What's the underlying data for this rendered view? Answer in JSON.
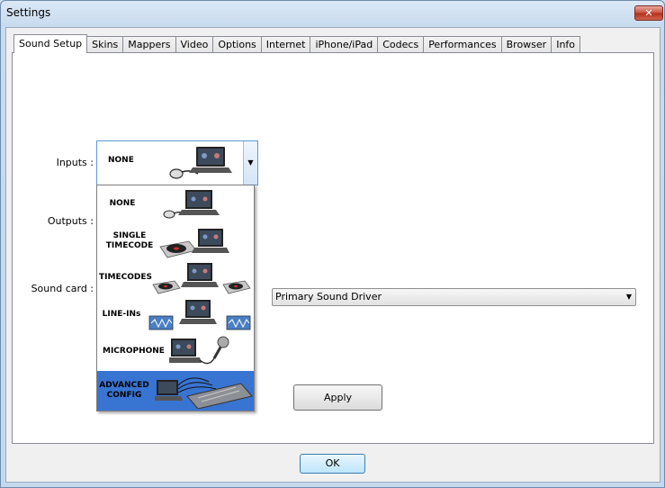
{
  "window": {
    "title": "Settings",
    "close_label": "✕"
  },
  "tabs": [
    {
      "label": "Sound Setup"
    },
    {
      "label": "Skins"
    },
    {
      "label": "Mappers"
    },
    {
      "label": "Video"
    },
    {
      "label": "Options"
    },
    {
      "label": "Internet"
    },
    {
      "label": "iPhone/iPad"
    },
    {
      "label": "Codecs"
    },
    {
      "label": "Performances"
    },
    {
      "label": "Browser"
    },
    {
      "label": "Info"
    }
  ],
  "labels": {
    "inputs": "Inputs :",
    "outputs": "Outputs :",
    "sound_card": "Sound card :"
  },
  "inputs_combo": {
    "value": "NONE",
    "arrow": "▼"
  },
  "inputs_options": [
    {
      "label": "NONE"
    },
    {
      "label": "SINGLE TIMECODE"
    },
    {
      "label": "TIMECODES"
    },
    {
      "label": "LINE-INs"
    },
    {
      "label": "MICROPHONE"
    },
    {
      "label": "ADVANCED CONFIG"
    }
  ],
  "sound_card_select": {
    "value": "Primary Sound Driver",
    "arrow": "▼"
  },
  "buttons": {
    "apply": "Apply",
    "ok": "OK"
  }
}
